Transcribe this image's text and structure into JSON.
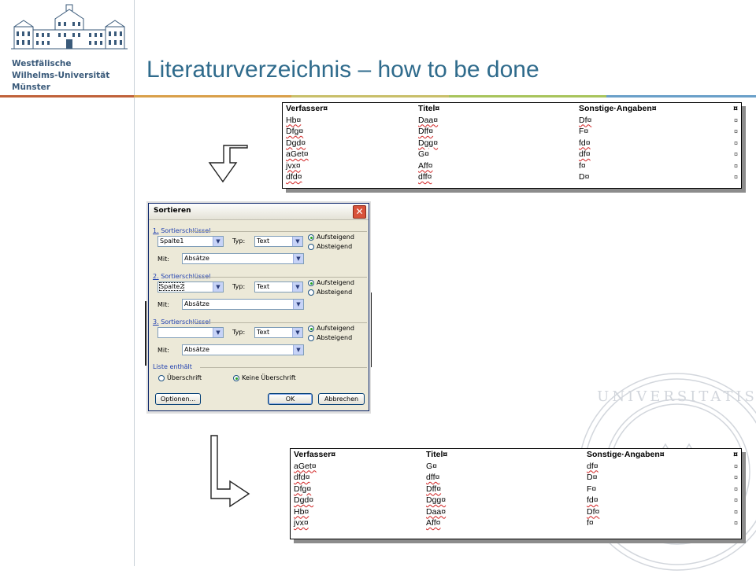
{
  "header": {
    "university_lines": [
      "Westfälische",
      "Wilhelms-Universität",
      "Münster"
    ],
    "title": "Literaturverzeichnis – how to be done",
    "accent_color": "#2f6b8c"
  },
  "table_before": {
    "headers": [
      "Verfasser¤",
      "Titel¤",
      "Sonstige·Angaben¤",
      "¤"
    ],
    "rows": [
      [
        "Hb¤",
        "Daa¤",
        "Df¤",
        "¤"
      ],
      [
        "Dfg¤",
        "Dff¤",
        "F¤",
        "¤"
      ],
      [
        "Dgd¤",
        "Dgg¤",
        "fd¤",
        "¤"
      ],
      [
        "aGet¤",
        "G¤",
        "df¤",
        "¤"
      ],
      [
        "jvx¤",
        "Aff¤",
        "f¤",
        "¤"
      ],
      [
        "dfd¤",
        "dff¤",
        "D¤",
        "¤"
      ]
    ]
  },
  "dialog": {
    "title": "Sortieren",
    "close_label": "✕",
    "key1": {
      "num": "1.",
      "label": "Sortierschlüssel",
      "column": "Spalte1",
      "type_label": "Typ:",
      "type": "Text",
      "with_label": "Mit:",
      "with": "Absätze",
      "asc": "Aufsteigend",
      "desc": "Absteigend"
    },
    "key2": {
      "num": "2.",
      "label": "Sortierschlüssel",
      "column": "Spalte2",
      "type_label": "Typ:",
      "type": "Text",
      "with_label": "Mit:",
      "with": "Absätze",
      "asc": "Aufsteigend",
      "desc": "Absteigend"
    },
    "key3": {
      "num": "3.",
      "label": "Sortierschlüssel",
      "column": "",
      "type_label": "Typ:",
      "type": "Text",
      "with_label": "Mit:",
      "with": "Absätze",
      "asc": "Aufsteigend",
      "desc": "Absteigend"
    },
    "list_contains": "Liste enthält",
    "opt_header": "Überschrift",
    "opt_no_header": "Keine Überschrift",
    "btn_options": "Optionen...",
    "btn_ok": "OK",
    "btn_cancel": "Abbrechen"
  },
  "table_after": {
    "headers": [
      "Verfasser¤",
      "Titel¤",
      "Sonstige·Angaben¤",
      "¤"
    ],
    "rows": [
      [
        "aGet¤",
        "G¤",
        "df¤",
        "¤"
      ],
      [
        "dfd¤",
        "dff¤",
        "D¤",
        "¤"
      ],
      [
        "Dfg¤",
        "Dff¤",
        "F¤",
        "¤"
      ],
      [
        "Dgd¤",
        "Dgg¤",
        "fd¤",
        "¤"
      ],
      [
        "Hb¤",
        "Daa¤",
        "Df¤",
        "¤"
      ],
      [
        "jvx¤",
        "Aff¤",
        "f¤",
        "¤"
      ]
    ]
  },
  "colors": {
    "bar": [
      "#c0623a",
      "#d9a04a",
      "#c9bf6a",
      "#a8c45c",
      "#6aa0c9"
    ]
  }
}
